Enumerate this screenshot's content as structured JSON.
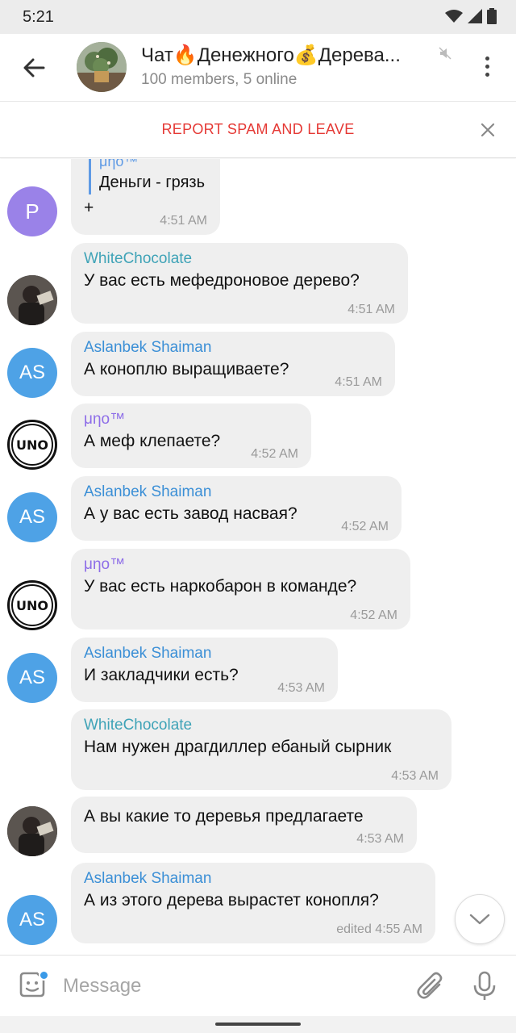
{
  "status": {
    "time": "5:21",
    "icons": [
      "wifi-icon",
      "signal-icon",
      "battery-icon"
    ]
  },
  "header": {
    "back_icon": "arrow-back-icon",
    "title": "Чат🔥Денежного💰Дерева...",
    "subtitle": "100 members, 5 online",
    "mute_icon": "mute-icon",
    "menu_icon": "more-vert-icon"
  },
  "spam_bar": {
    "label": "REPORT SPAM AND LEAVE",
    "close_icon": "close-icon"
  },
  "messages": [
    {
      "avatar_text": "P",
      "reply_name": "μηο™",
      "reply_text": "Деньги - грязь",
      "text": "+",
      "time": "4:51 AM"
    },
    {
      "sender": "WhiteChocolate",
      "text": "У вас есть мефедроновое дерево?",
      "time": "4:51 AM"
    },
    {
      "avatar_text": "AS",
      "sender": "Aslanbek Shaiman",
      "text": "А коноплю выращиваете?",
      "time": "4:51 AM"
    },
    {
      "avatar_text": "UNO",
      "sender": "μηο™",
      "text": "А меф клепаете?",
      "time": "4:52 AM"
    },
    {
      "avatar_text": "AS",
      "sender": "Aslanbek Shaiman",
      "text": "А у вас есть завод насвая?",
      "time": "4:52 AM"
    },
    {
      "avatar_text": "UNO",
      "sender": "μηο™",
      "text": "У вас есть наркобарон в команде?",
      "time": "4:52 AM"
    },
    {
      "avatar_text": "AS",
      "sender": "Aslanbek Shaiman",
      "text": "И закладчики есть?",
      "time": "4:53 AM"
    },
    {
      "sender": "WhiteChocolate",
      "text": "Нам нужен драгдиллер ебаный сырник",
      "time": "4:53 AM"
    },
    {
      "text": "А вы какие то деревья предлагаете",
      "time": "4:53 AM"
    },
    {
      "avatar_text": "AS",
      "sender": "Aslanbek Shaiman",
      "text": "А из этого дерева вырастет конопля?",
      "time": "edited 4:55 AM"
    }
  ],
  "input": {
    "placeholder": "Message",
    "sticker_icon": "sticker-icon",
    "attach_icon": "paperclip-icon",
    "mic_icon": "microphone-icon"
  },
  "scroll_button_icon": "chevron-down-icon",
  "colors": {
    "spam_red": "#e53935",
    "aslan_blue": "#3b8fd6",
    "white_chocolate_teal": "#3fa3b7",
    "mu_purple": "#8e6ee8",
    "avatar_blue": "#4ea2e6",
    "avatar_purple": "#9a82e8",
    "bubble": "#efefef"
  }
}
